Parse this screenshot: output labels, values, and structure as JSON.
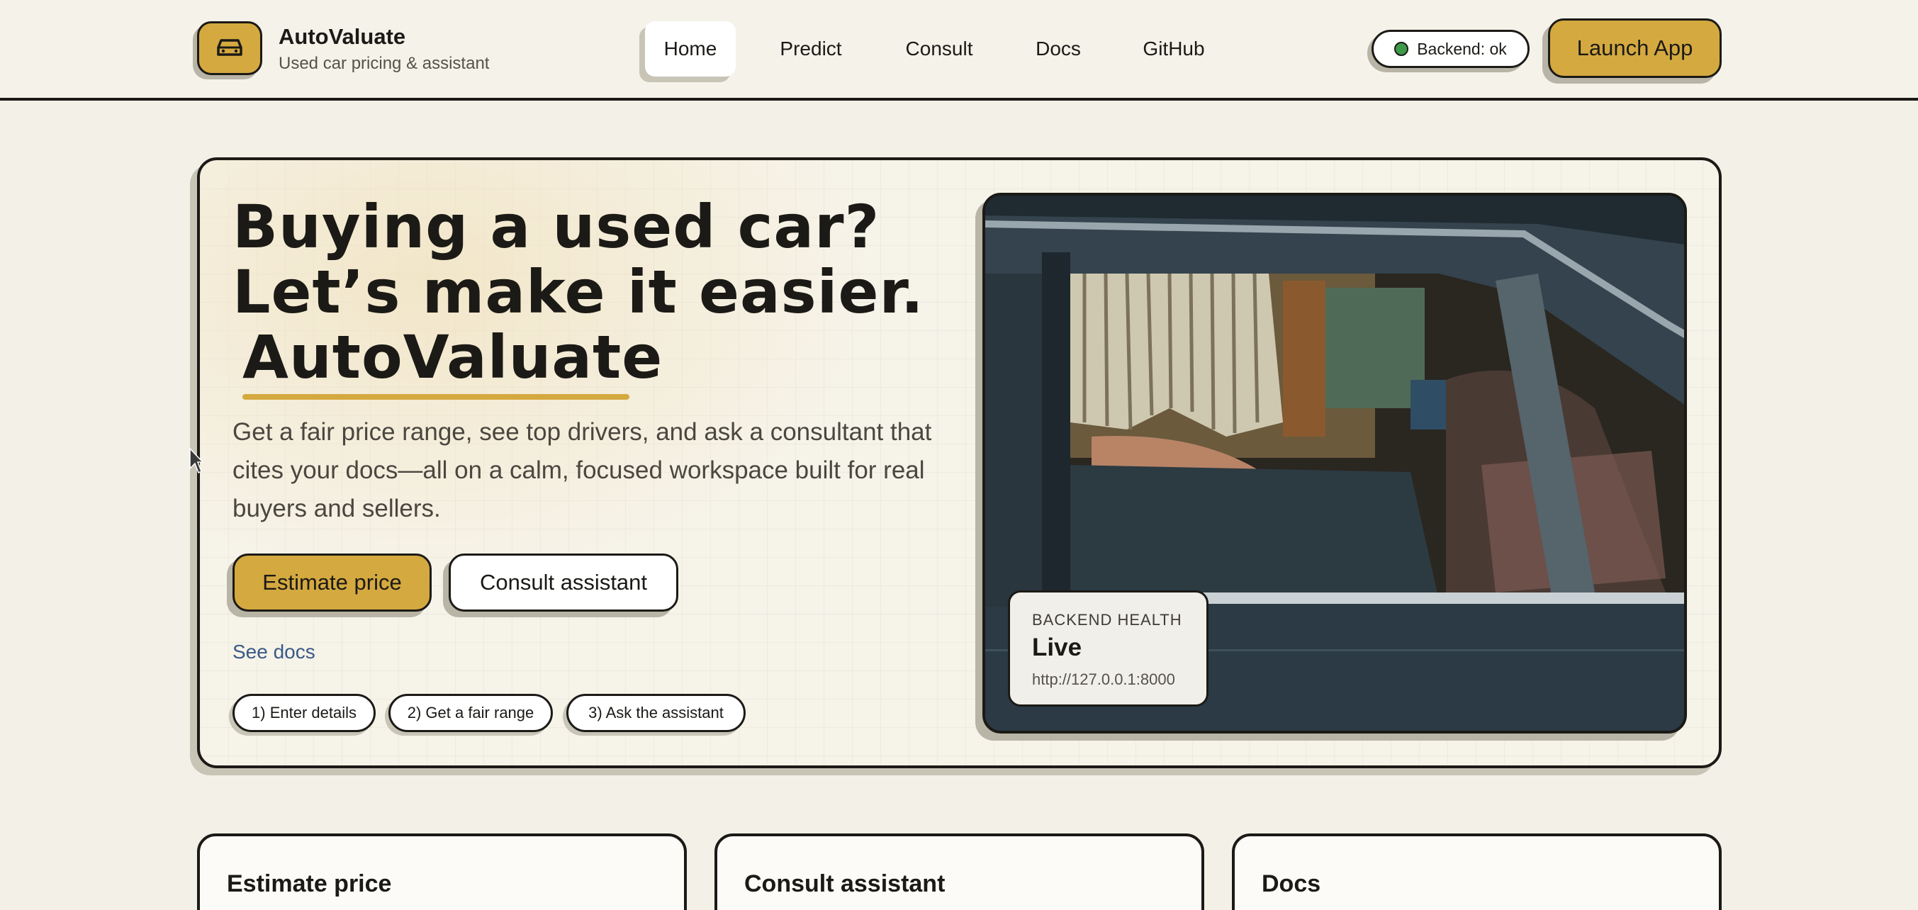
{
  "header": {
    "brand_name": "AutoValuate",
    "brand_subtitle": "Used car pricing & assistant",
    "logo_icon": "car-icon",
    "nav": [
      {
        "label": "Home",
        "active": true
      },
      {
        "label": "Predict",
        "active": false
      },
      {
        "label": "Consult",
        "active": false
      },
      {
        "label": "Docs",
        "active": false
      },
      {
        "label": "GitHub",
        "active": false
      }
    ],
    "status_label": "Backend: ok",
    "launch_label": "Launch App"
  },
  "hero": {
    "title_line1": "Buying a used car?",
    "title_line2": "Let’s make it easier.",
    "title_brand": "AutoValuate",
    "description": "Get a fair price range, see top drivers, and ask a consultant that cites your docs—all on a calm, focused workspace built for real buyers and sellers.",
    "primary_cta": "Estimate price",
    "secondary_cta": "Consult assistant",
    "docs_link": "See docs",
    "steps": [
      "1) Enter details",
      "2) Get a fair range",
      "3) Ask the assistant"
    ]
  },
  "health_card": {
    "label": "BACKEND HEALTH",
    "value": "Live",
    "url": "http://127.0.0.1:8000"
  },
  "features": [
    {
      "title": "Estimate price"
    },
    {
      "title": "Consult assistant"
    },
    {
      "title": "Docs"
    }
  ],
  "colors": {
    "accent": "#d4a940",
    "ink": "#1c1a16",
    "background": "#f3f1e7",
    "status_ok": "#3c9a4a",
    "link": "#3a5a86"
  }
}
